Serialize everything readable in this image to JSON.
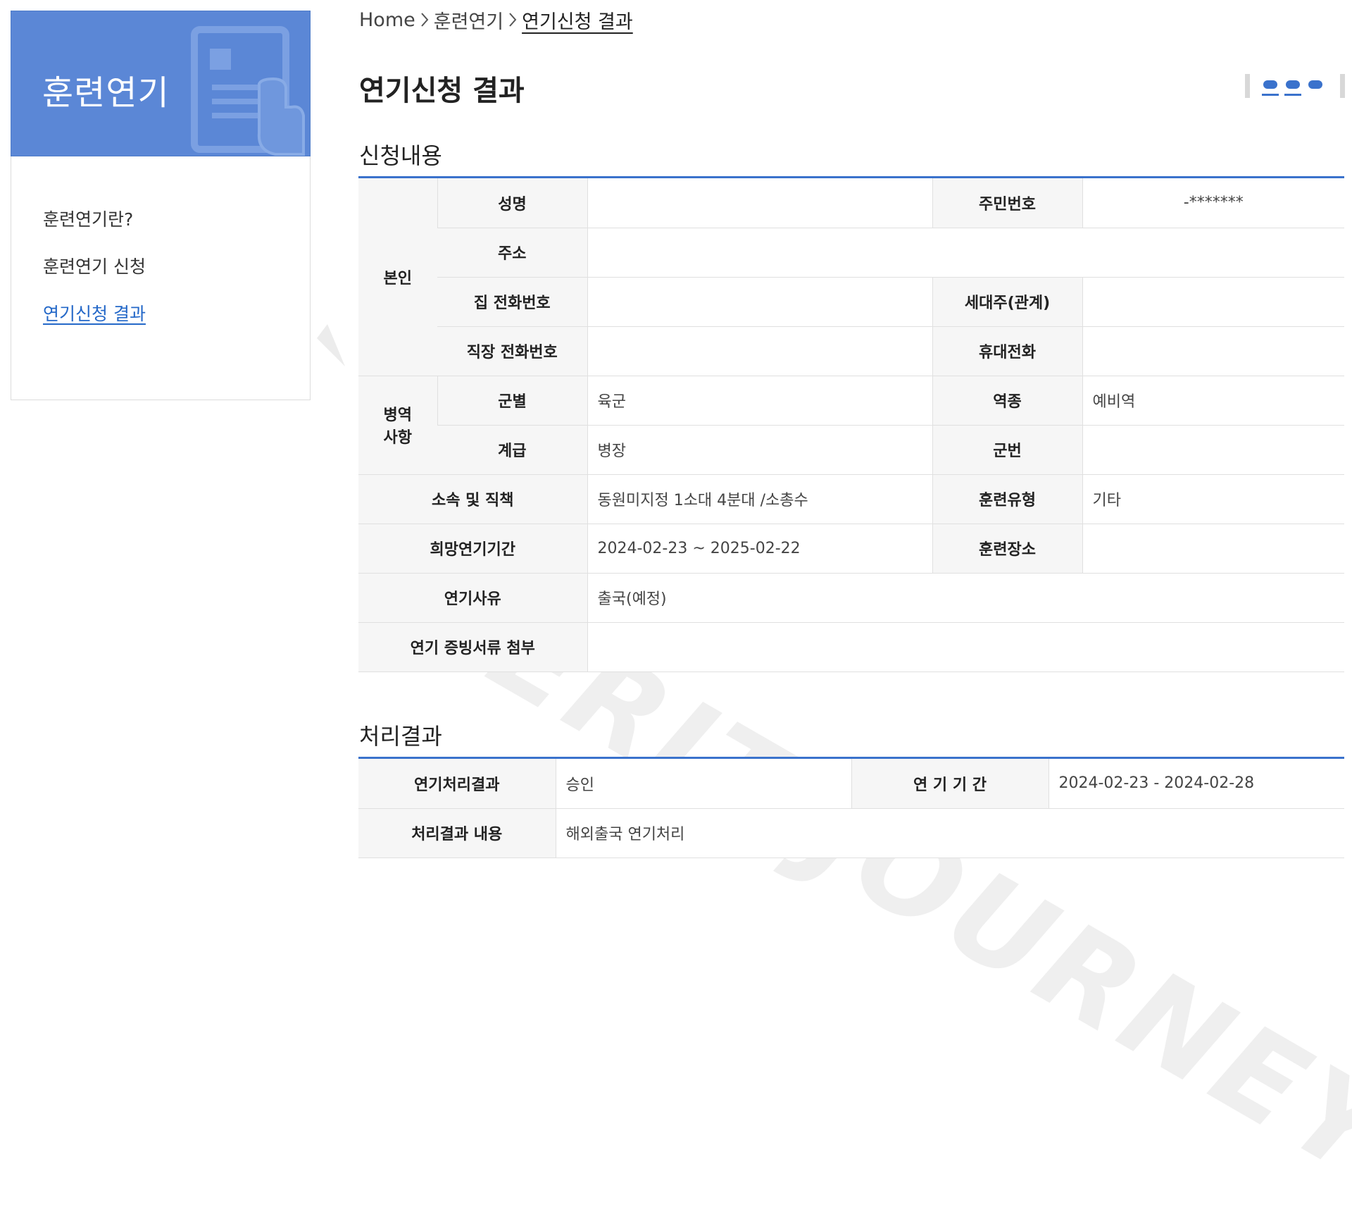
{
  "sidebar": {
    "title": "훈련연기",
    "items": [
      {
        "label": "훈련연기란?"
      },
      {
        "label": "훈련연기 신청"
      },
      {
        "label": "연기신청 결과"
      }
    ]
  },
  "breadcrumb": [
    "Home",
    "훈련연기",
    "연기신청 결과"
  ],
  "page_title": "연기신청 결과",
  "watermark": "MERIT JOURNEY",
  "application": {
    "section_title": "신청내용",
    "groups": {
      "self": "본인",
      "military_1": "병역",
      "military_2": "사항"
    },
    "labels": {
      "name": "성명",
      "resident_no": "주민번호",
      "address": "주소",
      "home_phone": "집 전화번호",
      "householder": "세대주(관계)",
      "work_phone": "직장 전화번호",
      "mobile": "휴대전화",
      "branch": "군별",
      "service_type": "역종",
      "rank": "계급",
      "service_no": "군번",
      "unit_duty": "소속 및 직책",
      "training_type": "훈련유형",
      "desired_period": "희망연기기간",
      "training_place": "훈련장소",
      "reason": "연기사유",
      "attachment": "연기 증빙서류 첨부"
    },
    "values": {
      "name": "",
      "resident_no": "-*******",
      "address": "",
      "home_phone": "",
      "householder": "",
      "work_phone": "",
      "mobile": "",
      "branch": "육군",
      "service_type": "예비역",
      "rank": "병장",
      "service_no": "",
      "unit_duty": "동원미지정 1소대 4분대 /소총수",
      "training_type": "기타",
      "desired_period": "2024-02-23 ~ 2025-02-22",
      "training_place": "",
      "reason": "출국(예정)",
      "attachment": ""
    }
  },
  "result": {
    "section_title": "처리결과",
    "labels": {
      "result": "연기처리결과",
      "period": "연 기 기 간",
      "content": "처리결과 내용"
    },
    "values": {
      "result": "승인",
      "period": "2024-02-23 - 2024-02-28",
      "content": "해외출국 연기처리"
    }
  },
  "colors": {
    "accent": "#5b87d6",
    "active_link": "#2468c8",
    "table_line": "#3a72cc"
  }
}
